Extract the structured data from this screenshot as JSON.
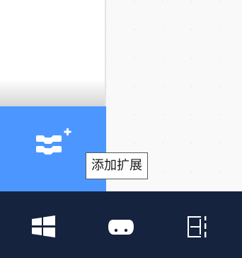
{
  "extensions": {
    "add_button_icon": "add-extension-icon",
    "tooltip": "添加扩展"
  },
  "taskbar": {
    "items": [
      {
        "icon": "windows-logo-icon"
      },
      {
        "icon": "gamepad-icon"
      },
      {
        "icon": "stage-layout-icon"
      }
    ]
  },
  "colors": {
    "accent": "#4c97ff",
    "taskbar_bg": "#16233e",
    "taskbar_icon": "#ffffff"
  }
}
